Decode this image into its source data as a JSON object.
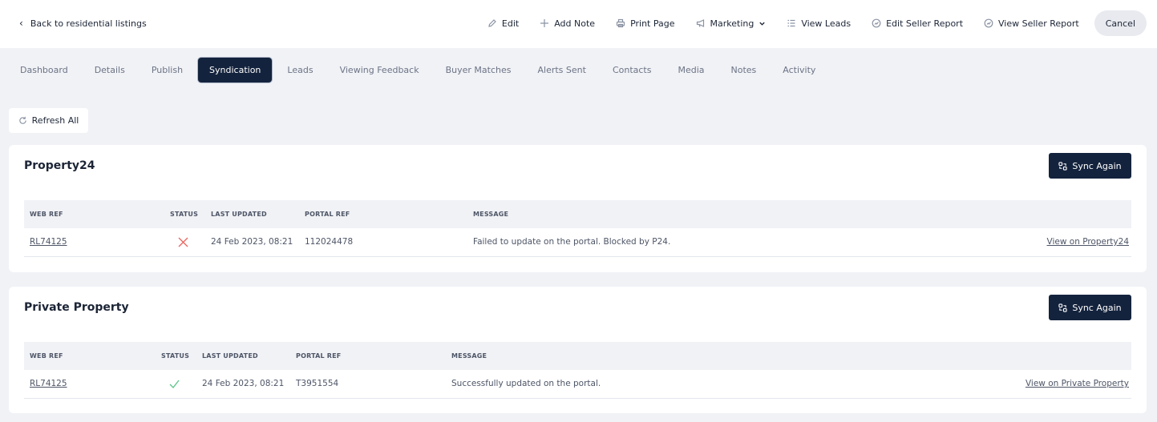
{
  "header": {
    "back_label": "Back to residential listings",
    "actions": {
      "edit": "Edit",
      "add_note": "Add Note",
      "print_page": "Print Page",
      "marketing": "Marketing",
      "view_leads": "View Leads",
      "edit_seller_report": "Edit Seller Report",
      "view_seller_report": "View Seller Report",
      "cancel": "Cancel"
    }
  },
  "tabs": [
    "Dashboard",
    "Details",
    "Publish",
    "Syndication",
    "Leads",
    "Viewing Feedback",
    "Buyer Matches",
    "Alerts Sent",
    "Contacts",
    "Media",
    "Notes",
    "Activity"
  ],
  "active_tab": "Syndication",
  "refresh_label": "Refresh All",
  "columns": {
    "web_ref": "WEB REF",
    "status": "STATUS",
    "last_updated": "LAST UPDATED",
    "portal_ref": "PORTAL REF",
    "message": "MESSAGE"
  },
  "portals": [
    {
      "title": "Property24",
      "sync_label": "Sync Again",
      "row": {
        "web_ref": "RL74125",
        "status": "failed",
        "last_updated": "24 Feb 2023, 08:21",
        "portal_ref": "112024478",
        "message": "Failed to update on the portal. Blocked by P24.",
        "view_link": "View on Property24"
      }
    },
    {
      "title": "Private Property",
      "sync_label": "Sync Again",
      "row": {
        "web_ref": "RL74125",
        "status": "success",
        "last_updated": "24 Feb 2023, 08:21",
        "portal_ref": "T3951554",
        "message": "Successfully updated on the portal.",
        "view_link": "View on Private Property"
      }
    }
  ],
  "colors": {
    "primary": "#14233d",
    "background": "#f1f2f6",
    "error": "#e8665f",
    "success": "#5cc48a"
  }
}
